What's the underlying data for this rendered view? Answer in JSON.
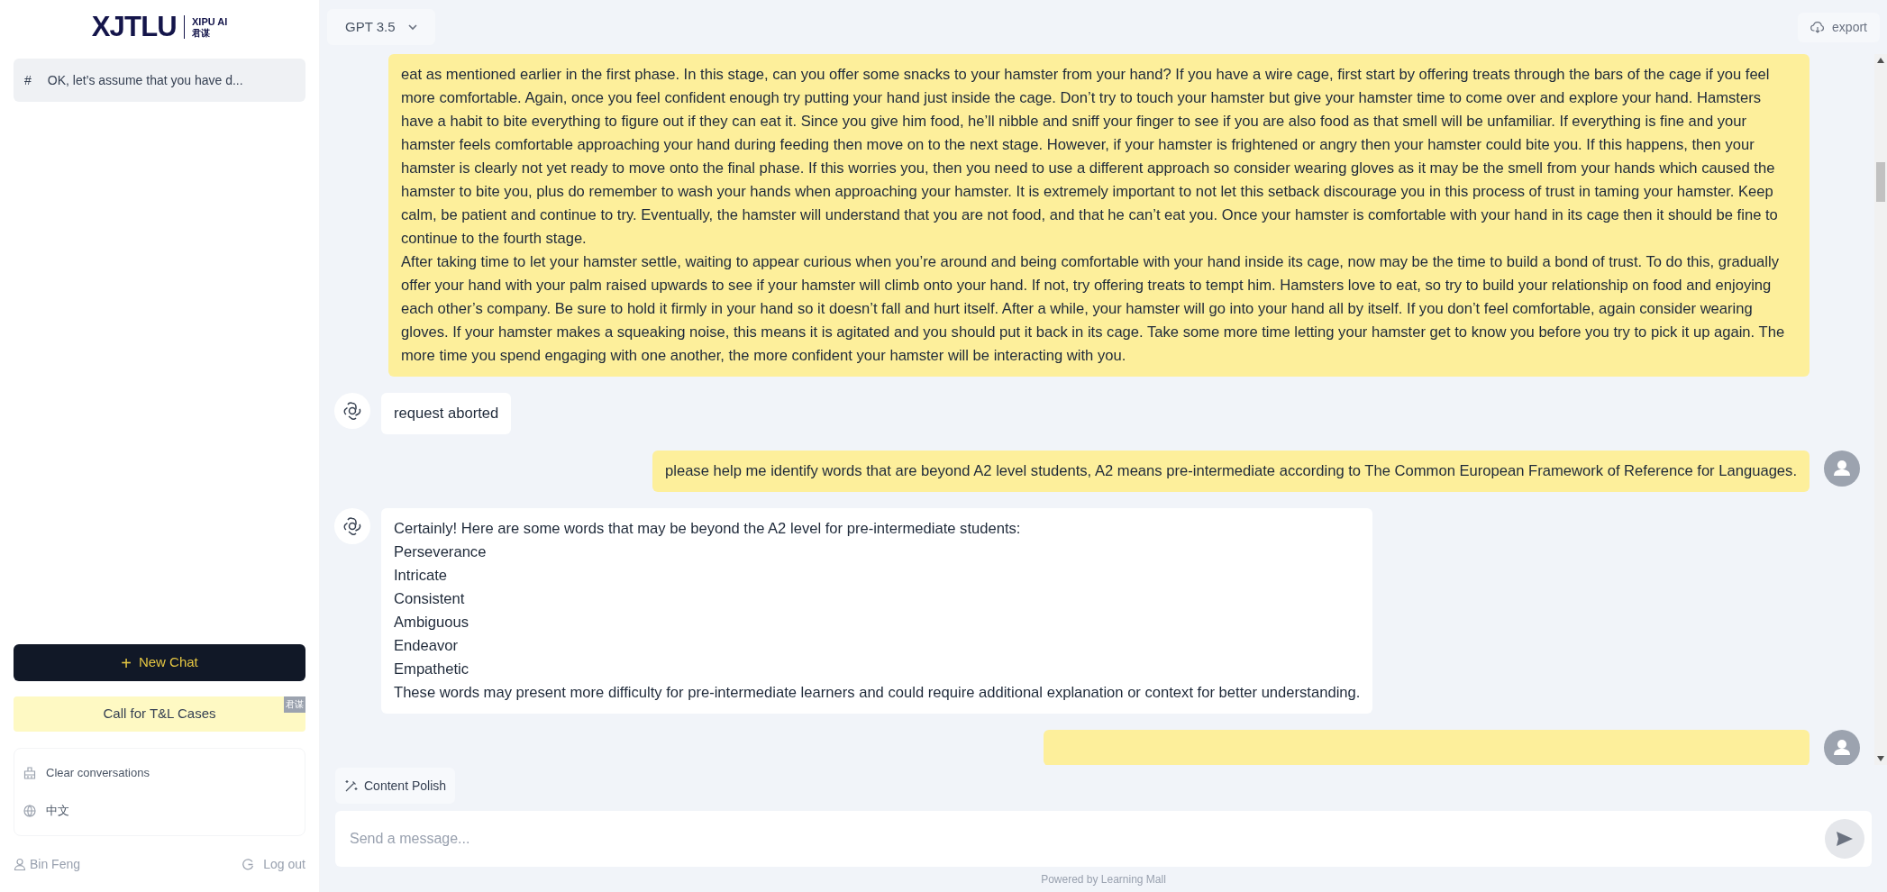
{
  "logo": {
    "name": "XJTLU",
    "product": "XIPU AI",
    "product_cn": "君谋"
  },
  "sidebar": {
    "conversations": [
      {
        "icon": "#",
        "title": "OK, let’s assume that you have d...",
        "selected": true
      }
    ],
    "new_chat": {
      "icon": "+",
      "label": "New Chat"
    },
    "promo": {
      "label": "Call for T&L Cases",
      "badge": "君谋"
    },
    "menu": [
      {
        "kind": "clear",
        "label": "Clear conversations"
      },
      {
        "kind": "language",
        "label": "中文"
      }
    ],
    "user": "Bin Feng",
    "logout": "Log out"
  },
  "header": {
    "model": "GPT 3.5",
    "export": "export"
  },
  "messages": [
    {
      "kind": "user",
      "lines": [
        "eat as mentioned earlier in the first phase. In this stage, can you offer some snacks to your hamster from your hand? If you have a wire cage, first start by offering treats through the bars of the cage if you feel more comfortable. Again, once you feel confident enough try putting your hand just inside the cage. Don’t try to touch your hamster but give your hamster time to come over and explore your hand. Hamsters have a habit to bite everything to figure out if they can eat it. Since you give him food, he’ll nibble and sniff your finger to see if you are also food as that smell will be unfamiliar. If everything is fine and your hamster feels comfortable approaching your hand during feeding then move on to the next stage. However, if your hamster is frightened or angry then your hamster could bite you. If this happens, then your hamster is clearly not yet ready to move onto the final phase. If this worries you, then you need to use a different approach so consider wearing gloves as it may be the smell from your hands which caused the hamster to bite you, plus do remember to wash your hands when approaching your hamster. It is extremely important to not let this setback discourage you in this process of trust in taming your hamster. Keep calm, be patient and continue to try. Eventually, the hamster will understand that you are not food, and that he can’t eat you. Once your hamster is comfortable with your hand in its cage then it should be fine to continue to the fourth stage.",
        "After taking time to let your hamster settle, waiting to appear curious when you’re around and being comfortable with your hand inside its cage, now may be the time to build a bond of trust. To do this, gradually offer your hand with your palm raised upwards to see if your hamster will climb onto your hand. If not, try offering treats to tempt him. Hamsters love to eat, so try to build your relationship on food and enjoying each other’s company. Be sure to hold it firmly in your hand so it doesn’t fall and hurt itself. After a while, your hamster will go into your hand all by itself. If you don’t feel comfortable, again consider wearing gloves. If your hamster makes a squeaking noise, this means it is agitated and you should put it back in its cage. Take some more time letting your hamster get to know you before you try to pick it up again. The more time you spend engaging with one another, the more confident your hamster will be interacting with you."
      ]
    },
    {
      "kind": "assistant",
      "lines": [
        "request aborted"
      ]
    },
    {
      "kind": "user",
      "lines": [
        "please help me identify words that are beyond A2 level students, A2 means pre-intermediate according to The Common European Framework of Reference for Languages."
      ]
    },
    {
      "kind": "assistant",
      "lines": [
        "Certainly! Here are some words that may be beyond the A2 level for pre-intermediate students:",
        "Perseverance",
        "Intricate",
        "Consistent",
        "Ambiguous",
        "Endeavor",
        "Empathetic",
        "These words may present more difficulty for pre-intermediate learners and could require additional explanation or context for better understanding."
      ]
    },
    {
      "kind": "user"
    }
  ],
  "composer": {
    "tool": "Content Polish",
    "placeholder": "Send a message...",
    "footer": "Powered by Learning Mall"
  }
}
